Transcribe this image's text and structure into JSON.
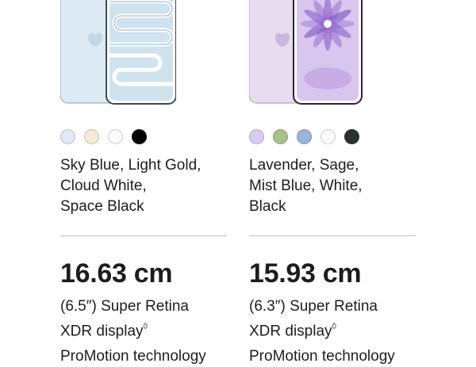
{
  "products": [
    {
      "id": "left",
      "swatches": [
        {
          "name": "sky-blue",
          "color": "#dfeaf4"
        },
        {
          "name": "light-gold",
          "color": "#f4ead8"
        },
        {
          "name": "cloud-white",
          "color": "#fbfbfb"
        },
        {
          "name": "space-black",
          "color": "#000000"
        }
      ],
      "color_lines": [
        "Sky Blue, Light Gold,",
        "Cloud White,",
        "Space Black"
      ],
      "size": "16.63 cm",
      "display_line1": "(6.5″) Super Retina",
      "display_line2": "XDR display",
      "footnote": "◊",
      "feature": "ProMotion technology"
    },
    {
      "id": "right",
      "swatches": [
        {
          "name": "lavender",
          "color": "#dccbf0"
        },
        {
          "name": "sage",
          "color": "#a7c08c"
        },
        {
          "name": "mist-blue",
          "color": "#9db3d8"
        },
        {
          "name": "white",
          "color": "#fbfbfb"
        },
        {
          "name": "black",
          "color": "#2b2f30"
        }
      ],
      "color_lines": [
        "Lavender, Sage,",
        "Mist Blue, White,",
        "Black"
      ],
      "size": "15.93 cm",
      "display_line1": "(6.3″) Super Retina",
      "display_line2": "XDR display",
      "footnote": "◊",
      "feature": "ProMotion technology"
    }
  ]
}
